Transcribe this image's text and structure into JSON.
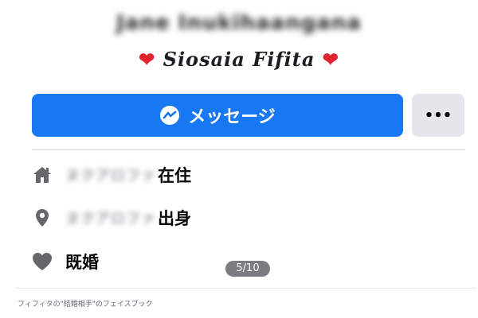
{
  "profile": {
    "name": "Jane Inukihaangana",
    "subtitle_heart_left": "❤",
    "subtitle_text": "Siosaia Fifita",
    "subtitle_heart_right": "❤"
  },
  "actions": {
    "message_label": "メッセージ",
    "more_label": "•••"
  },
  "info": [
    {
      "icon": "home-icon",
      "hidden_value": "ヌクアロファ",
      "label": "在住"
    },
    {
      "icon": "location-pin-icon",
      "hidden_value": "ヌクアロファ",
      "label": "出身"
    },
    {
      "icon": "heart-icon",
      "hidden_value": "",
      "label": "既婚"
    }
  ],
  "pager": {
    "text": "5/10"
  },
  "caption": "フィフィタの\"結婚相手\"のフェイスブック",
  "colors": {
    "primary": "#1877f2",
    "secondary_button": "#e4e6eb",
    "icon_gray": "#65676b",
    "heart_red": "#e0242f"
  }
}
